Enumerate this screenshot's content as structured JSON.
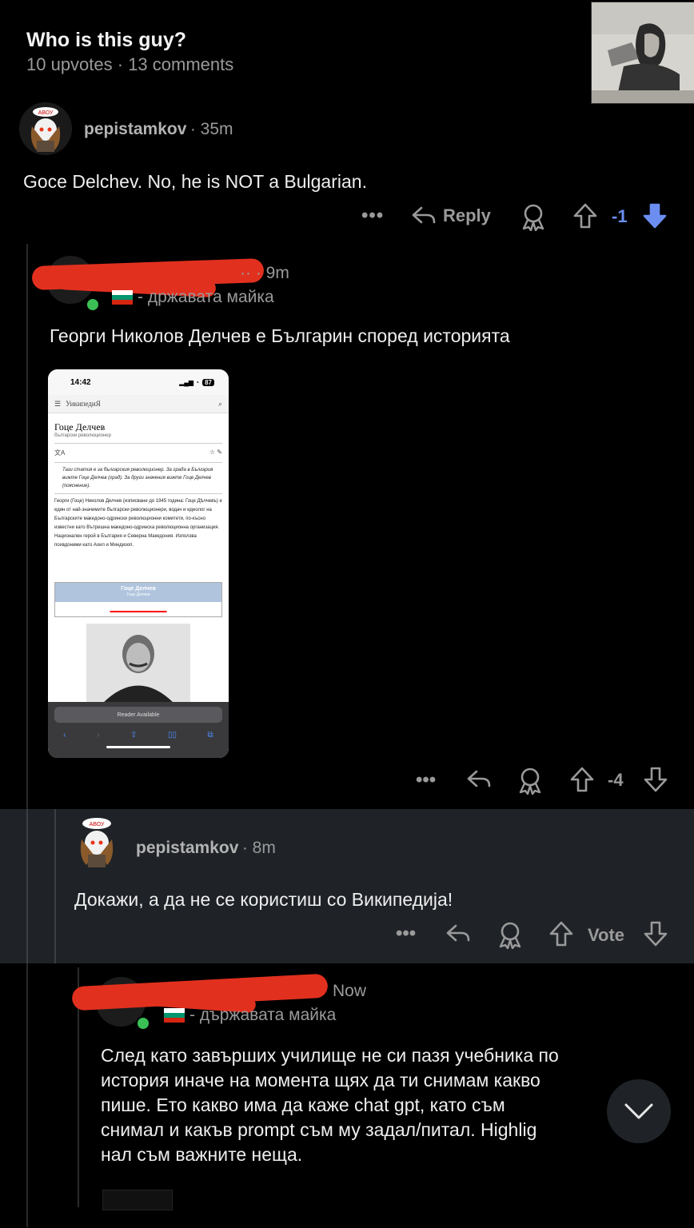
{
  "post": {
    "title": "Who is this guy?",
    "meta": "10 upvotes · 13 comments"
  },
  "comments": [
    {
      "user": "pepistamkov",
      "time": "· 35m",
      "text": "Goce Delchev. No, he is NOT a Bulgarian.",
      "reply_label": "Reply",
      "score": "-1"
    },
    {
      "user_partial": "·· · 9m",
      "flair": "- државата майка",
      "text": "Георги Николов Делчев е Българин според историята",
      "score": "-4",
      "screenshot": {
        "status_time": "14:42",
        "battery": "87",
        "site": "УикипедиЯ",
        "article_title": "Гоце Делчев",
        "article_subtitle": "български революционер",
        "note": "Тази статия е за българския революционер. За града в България вижте Гоце Делчев (град). За други значения вижте Гоце Делчев (пояснение).",
        "para": "Георги (Гоце) Николов Делчев (изписване до 1945 година: Гоце Дѣлчевъ) е един от най-значимите български революционери, водач и идеолог на Българските македоно-одрински революционни комитети, по-късно известни като Вътрешна македоно-одринска революционна организация. Национален герой в България и Северна Македония. Използва псевдоними като Ахил и Миндизоп.",
        "infobox_title": "Гоце Делчев",
        "infobox_sub": "Гоце Делчев",
        "infobox_role": "български революционер",
        "reader": "Reader Available"
      }
    },
    {
      "user": "pepistamkov",
      "time": "· 8m",
      "text": "Докажи, а да не се користиш со Википедија!",
      "vote_label": "Vote"
    },
    {
      "time": "Now",
      "flair": "- държавата майка",
      "text_lines": [
        "След като завърших училище не си пазя учебника по",
        "история иначе на момента щях да ти снимам какво",
        "пише. Ето какво има да каже chat gpt, като съм",
        "снимал и какъв prompt съм му задал/питал. Highlig",
        "нал съм важните неща."
      ]
    }
  ],
  "icons": {
    "more": "more-icon",
    "reply": "reply-icon",
    "award": "award-icon",
    "upvote": "upvote-icon",
    "downvote": "downvote-icon",
    "scroll": "chevron-down-icon"
  },
  "colors": {
    "background": "#000000",
    "highlight_row": "#1f2328",
    "downvote_active": "#6b8ef0",
    "redaction": "#e2301f"
  }
}
